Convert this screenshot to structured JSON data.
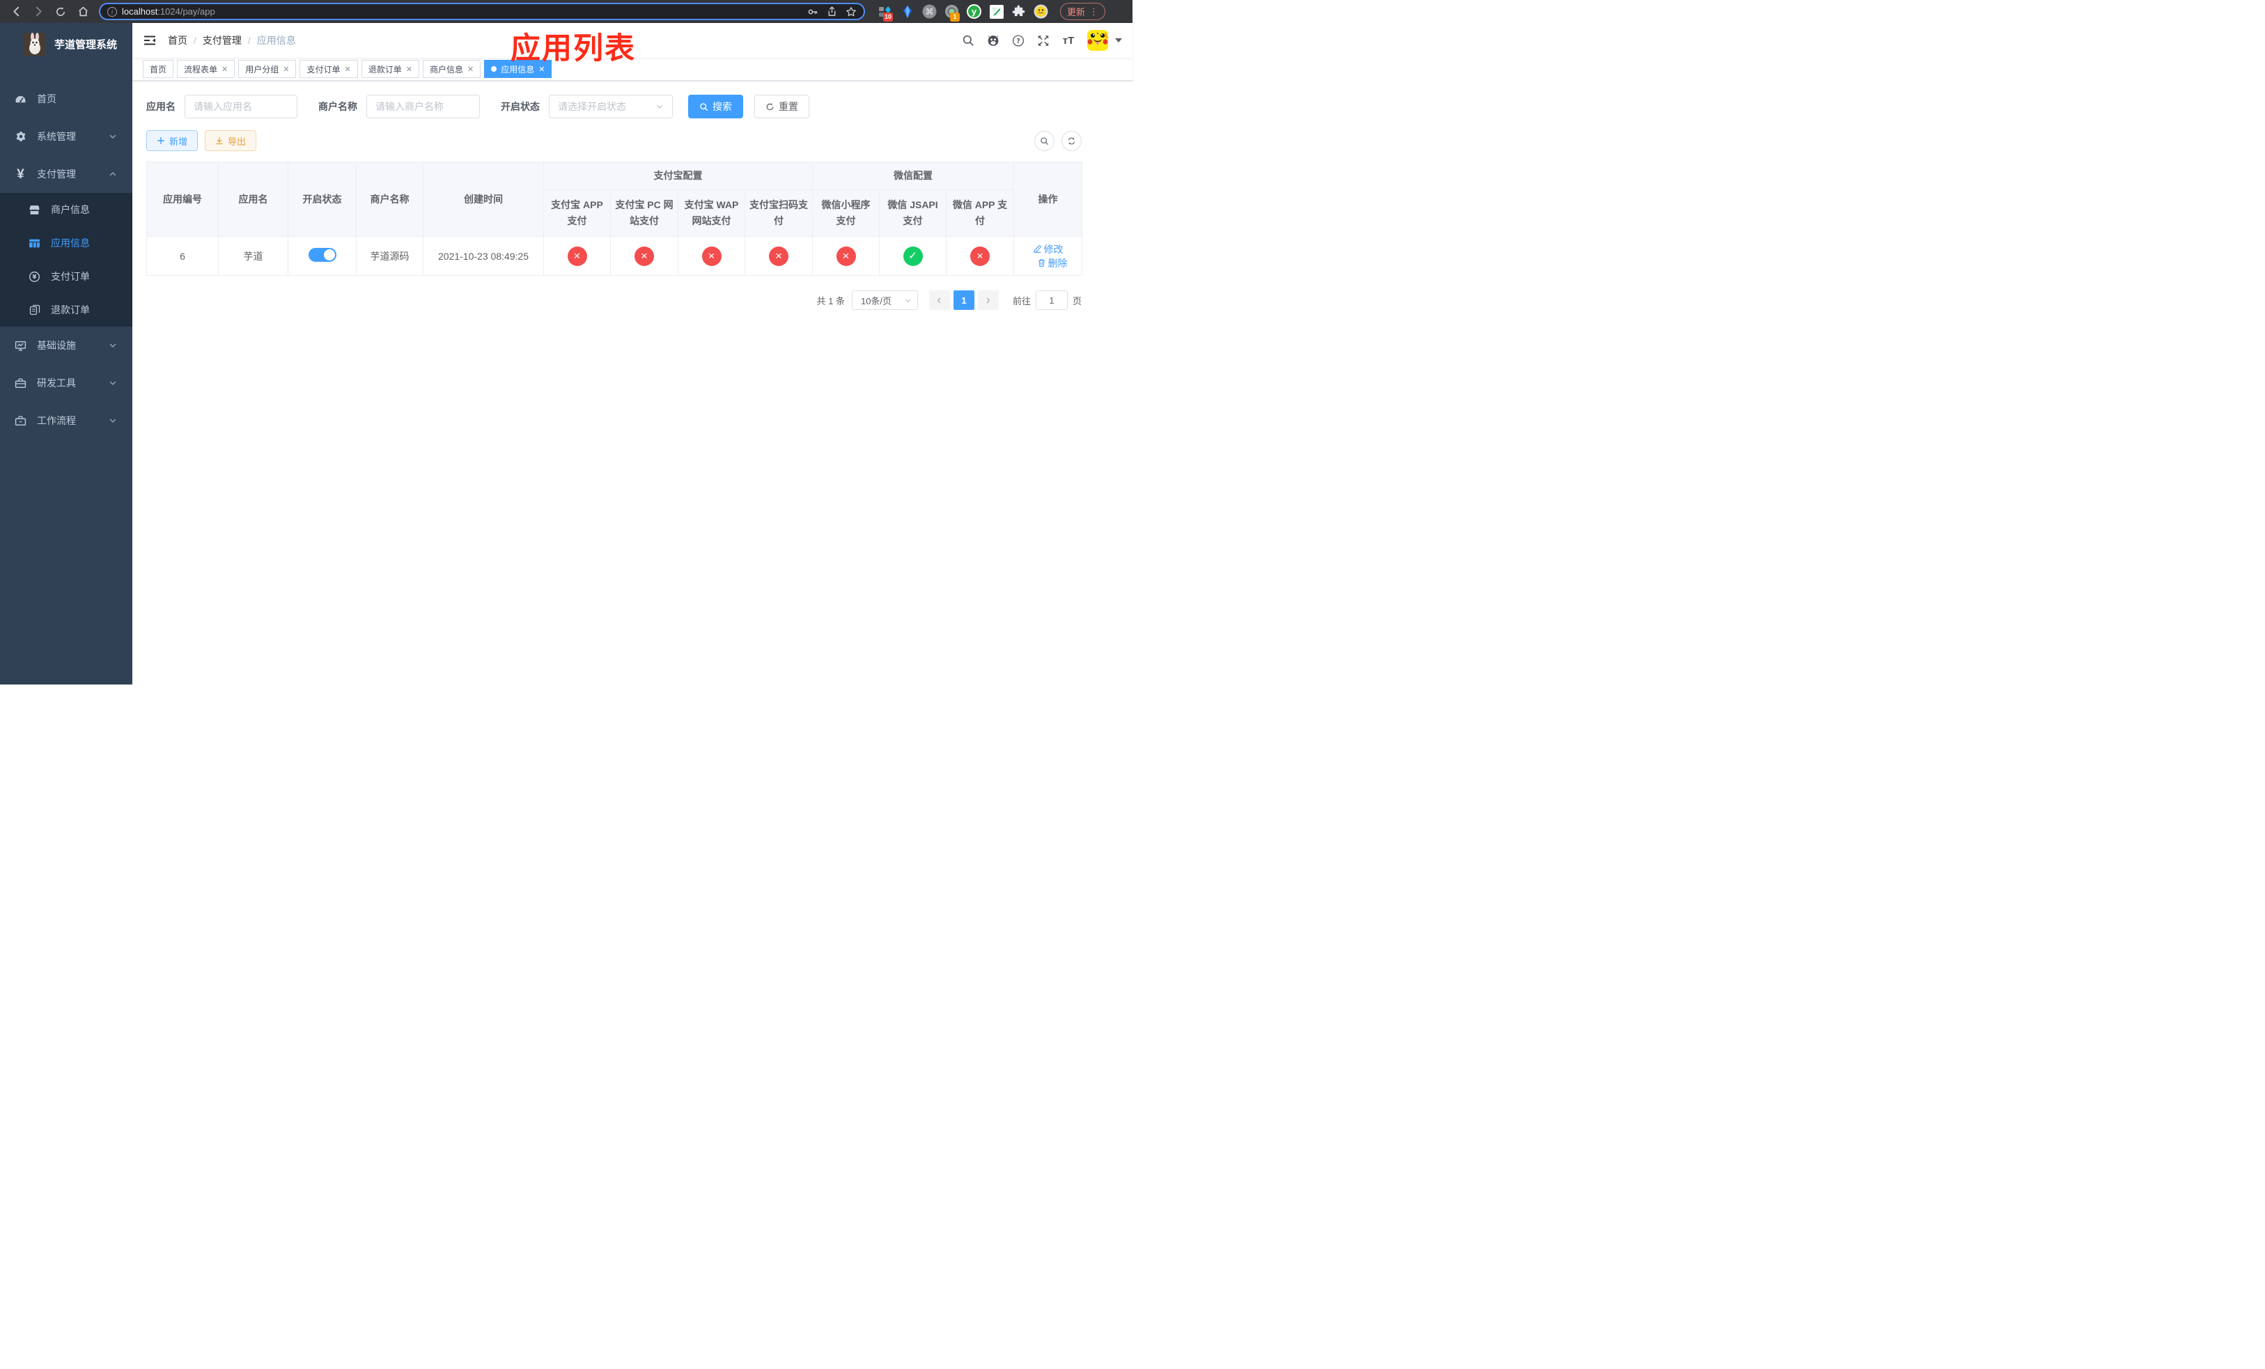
{
  "browser": {
    "url_host": "localhost",
    "url_rest": ":1024/pay/app",
    "ext_badge_blue": "10",
    "ext_badge_camera": "1",
    "ext_y_label": "y",
    "update_button": "更新"
  },
  "sidebar": {
    "logo_title": "芋道管理系统",
    "items": [
      {
        "label": "首页",
        "icon": "dashboard-icon"
      },
      {
        "label": "系统管理",
        "icon": "gear-icon",
        "expandable": true
      },
      {
        "label": "支付管理",
        "icon": "yen-icon",
        "expandable": true,
        "expanded": true
      },
      {
        "label": "商户信息",
        "icon": "shop-icon"
      },
      {
        "label": "应用信息",
        "icon": "grid-icon",
        "active": true
      },
      {
        "label": "支付订单",
        "icon": "pay-order-icon"
      },
      {
        "label": "退款订单",
        "icon": "refund-icon"
      },
      {
        "label": "基础设施",
        "icon": "monitor-icon",
        "expandable": true
      },
      {
        "label": "研发工具",
        "icon": "toolbox-icon",
        "expandable": true
      },
      {
        "label": "工作流程",
        "icon": "workflow-icon",
        "expandable": true
      }
    ]
  },
  "navbar": {
    "breadcrumb": [
      "首页",
      "支付管理",
      "应用信息"
    ],
    "breadcrumb_separator": "/",
    "annotation": "应用列表"
  },
  "tags": [
    {
      "label": "首页"
    },
    {
      "label": "流程表单",
      "closable": true
    },
    {
      "label": "用户分组",
      "closable": true
    },
    {
      "label": "支付订单",
      "closable": true
    },
    {
      "label": "退款订单",
      "closable": true
    },
    {
      "label": "商户信息",
      "closable": true
    },
    {
      "label": "应用信息",
      "closable": true,
      "active": true
    }
  ],
  "search": {
    "app_name_label": "应用名",
    "app_name_placeholder": "请输入应用名",
    "merchant_label": "商户名称",
    "merchant_placeholder": "请输入商户名称",
    "status_label": "开启状态",
    "status_placeholder": "请选择开启状态",
    "search_button": "搜索",
    "reset_button": "重置"
  },
  "toolbar": {
    "add_button": "新增",
    "export_button": "导出"
  },
  "table": {
    "simple_columns": [
      "应用编号",
      "应用名",
      "开启状态",
      "商户名称",
      "创建时间"
    ],
    "groups": [
      {
        "label": "支付宝配置",
        "children": [
          "支付宝 APP 支付",
          "支付宝 PC 网站支付",
          "支付宝 WAP 网站支付",
          "支付宝扫码支付"
        ]
      },
      {
        "label": "微信配置",
        "children": [
          "微信小程序支付",
          "微信 JSAPI 支付",
          "微信 APP 支付"
        ]
      }
    ],
    "op_column": "操作",
    "rows": [
      {
        "id": "6",
        "name": "芋道",
        "enabled": true,
        "merchant": "芋道源码",
        "created": "2021-10-23 08:49:25",
        "pay_status": [
          false,
          false,
          false,
          false,
          false,
          true,
          false
        ],
        "edit_action": "修改",
        "delete_action": "删除"
      }
    ]
  },
  "pagination": {
    "total": "共 1 条",
    "page_size": "10条/页",
    "current_page": "1",
    "goto_label": "前往",
    "goto_value": "1",
    "goto_suffix": "页"
  },
  "colors": {
    "accent": "#409eff",
    "success": "#13ce66",
    "danger": "#f34d4d",
    "warning": "#e6a23c",
    "sidebar_bg": "#304156",
    "submenu_bg": "#1f2d3d",
    "annotation_red": "#fd2b18"
  }
}
